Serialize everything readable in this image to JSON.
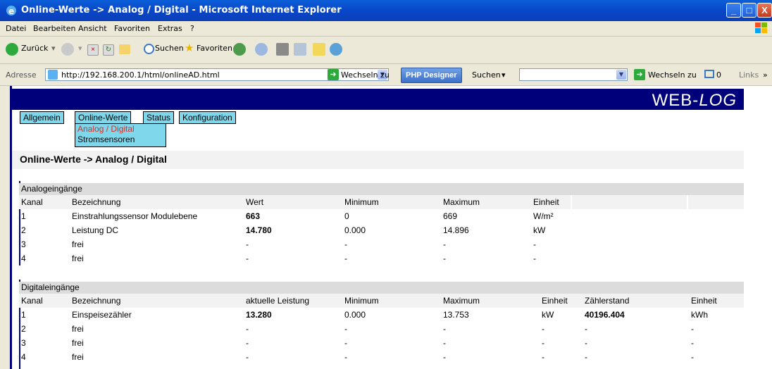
{
  "window": {
    "title": "Online-Werte -> Analog / Digital - Microsoft Internet Explorer",
    "minimize": "_",
    "maximize": "□",
    "close": "X"
  },
  "menu": [
    "Datei",
    "Bearbeiten",
    "Ansicht",
    "Favoriten",
    "Extras",
    "?"
  ],
  "toolbar": {
    "back": "Zurück",
    "search": "Suchen",
    "favorites": "Favoriten"
  },
  "address": {
    "label": "Adresse",
    "url": "http://192.168.200.1/html/onlineAD.html",
    "go": "Wechseln zu",
    "php_designer": "PHP Designer",
    "search_label": "Suchen",
    "go2": "Wechseln zu",
    "count": "0",
    "links": "Links"
  },
  "page": {
    "brand_prefix": "WEB-",
    "brand_suffix": "LOG",
    "tabs": [
      "Allgemein",
      "Online-Werte",
      "Status",
      "Konfiguration"
    ],
    "submenu": [
      "Analog / Digital",
      "Stromsensoren"
    ],
    "title": "Online-Werte -> Analog / Digital"
  },
  "analog": {
    "heading": "Analogeingänge",
    "columns": [
      "Kanal",
      "Bezeichnung",
      "Wert",
      "Minimum",
      "Maximum",
      "Einheit"
    ],
    "rows": [
      {
        "kanal": "1",
        "name": "Einstrahlungssensor Modulebene",
        "wert": "663",
        "min": "0",
        "max": "669",
        "unit": "W/m²"
      },
      {
        "kanal": "2",
        "name": "Leistung DC",
        "wert": "14.780",
        "min": "0.000",
        "max": "14.896",
        "unit": "kW"
      },
      {
        "kanal": "3",
        "name": "frei",
        "wert": "-",
        "min": "-",
        "max": "-",
        "unit": "-"
      },
      {
        "kanal": "4",
        "name": "frei",
        "wert": "-",
        "min": "-",
        "max": "-",
        "unit": "-"
      }
    ]
  },
  "digital": {
    "heading": "Digitaleingänge",
    "columns": [
      "Kanal",
      "Bezeichnung",
      "aktuelle Leistung",
      "Minimum",
      "Maximum",
      "Einheit",
      "Zählerstand",
      "Einheit"
    ],
    "rows": [
      {
        "kanal": "1",
        "name": "Einspeisezähler",
        "wert": "13.280",
        "min": "0.000",
        "max": "13.753",
        "unit": "kW",
        "count": "40196.404",
        "unit2": "kWh"
      },
      {
        "kanal": "2",
        "name": "frei",
        "wert": "-",
        "min": "-",
        "max": "-",
        "unit": "-",
        "count": "-",
        "unit2": "-"
      },
      {
        "kanal": "3",
        "name": "frei",
        "wert": "-",
        "min": "-",
        "max": "-",
        "unit": "-",
        "count": "-",
        "unit2": "-"
      },
      {
        "kanal": "4",
        "name": "frei",
        "wert": "-",
        "min": "-",
        "max": "-",
        "unit": "-",
        "count": "-",
        "unit2": "-"
      }
    ]
  }
}
